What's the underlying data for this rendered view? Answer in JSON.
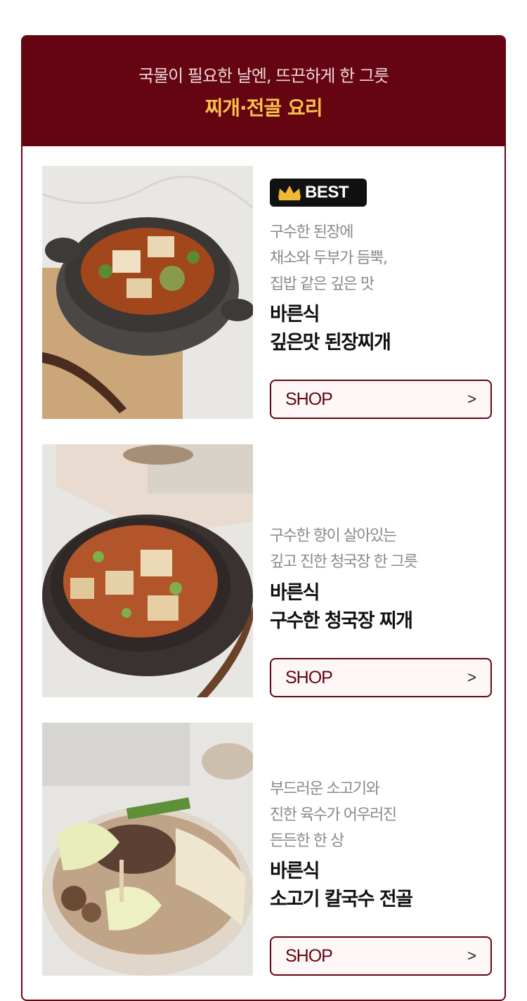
{
  "header": {
    "subtitle": "국물이 필요한 날엔, 뜨끈하게 한 그릇",
    "title": "찌개·전골 요리"
  },
  "products": [
    {
      "badge": "BEST",
      "desc": [
        "구수한 된장에",
        "채소와 두부가 듬뿍,",
        "집밥 같은 깊은 맛"
      ],
      "name": [
        "바른식",
        "깊은맛 된장찌개"
      ],
      "button": "SHOP",
      "arrow": ">"
    },
    {
      "desc": [
        "구수한 향이 살아있는",
        "깊고 진한 청국장 한 그릇"
      ],
      "name": [
        "바른식",
        "구수한 청국장 찌개"
      ],
      "button": "SHOP",
      "arrow": ">"
    },
    {
      "desc": [
        "부드러운 소고기와",
        "진한 육수가 어우러진",
        "든든한 한 상"
      ],
      "name": [
        "바른식",
        "소고기 칼국수 전골"
      ],
      "button": "SHOP",
      "arrow": ">"
    }
  ],
  "colors": {
    "brand": "#650511",
    "title_accent": "#f7c24a",
    "button_bg": "#fdf7f7"
  },
  "icons": [
    "crown-icon",
    "chevron-right-icon"
  ]
}
